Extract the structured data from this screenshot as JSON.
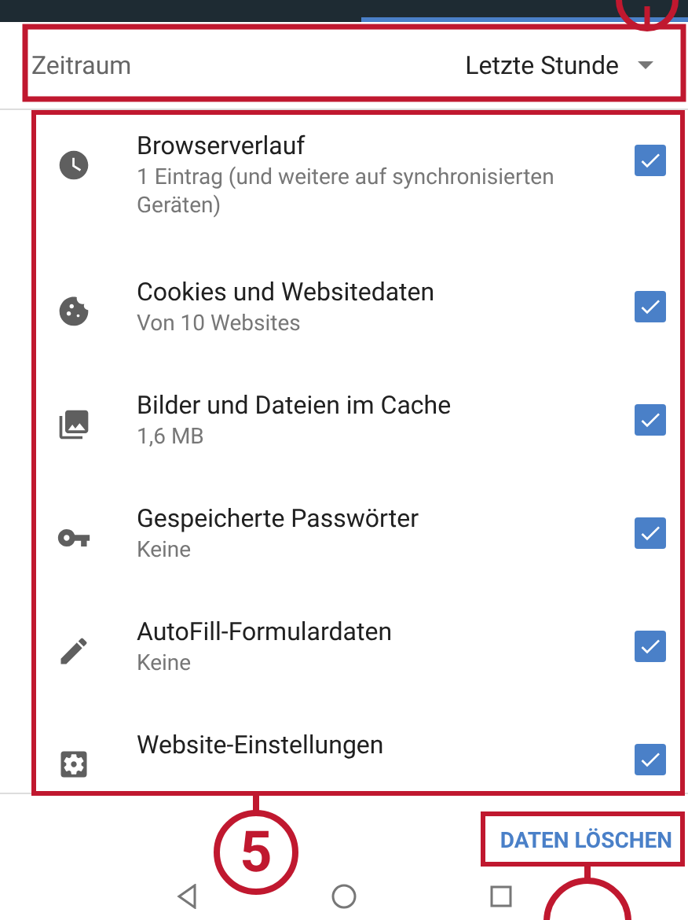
{
  "time_range": {
    "label": "Zeitraum",
    "value": "Letzte Stunde"
  },
  "items": [
    {
      "kind": "history",
      "title": "Browserverlauf",
      "subtitle": "1 Eintrag (und weitere auf synchronisierten Geräten)",
      "checked": true
    },
    {
      "kind": "cookies",
      "title": "Cookies und Websitedaten",
      "subtitle": "Von 10 Websites",
      "checked": true
    },
    {
      "kind": "cache",
      "title": "Bilder und Dateien im Cache",
      "subtitle": "1,6 MB",
      "checked": true
    },
    {
      "kind": "passwords",
      "title": "Gespeicherte Passwörter",
      "subtitle": "Keine",
      "checked": true
    },
    {
      "kind": "autofill",
      "title": "AutoFill-Formulardaten",
      "subtitle": "Keine",
      "checked": true
    },
    {
      "kind": "site_settings",
      "title": "Website-Einstellungen",
      "checked": true
    }
  ],
  "clear_button": "DATEN LÖSCHEN",
  "callouts": [
    {
      "label": "5"
    }
  ]
}
